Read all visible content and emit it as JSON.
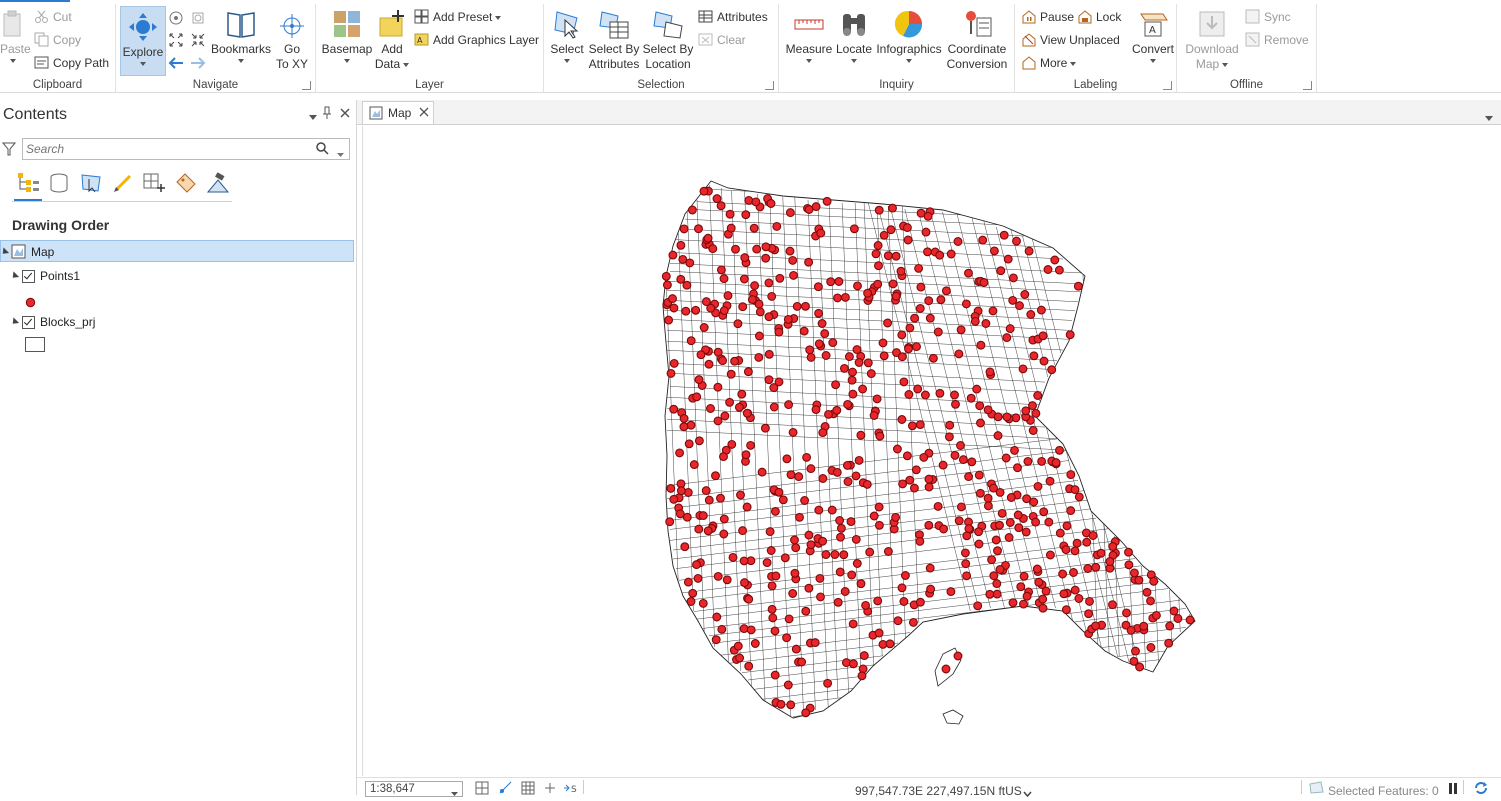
{
  "ribbon": {
    "clipboard": {
      "label": "Clipboard",
      "paste": "Paste",
      "cut": "Cut",
      "copy": "Copy",
      "copy_path": "Copy Path"
    },
    "navigate": {
      "label": "Navigate",
      "explore": "Explore",
      "bookmarks": "Bookmarks",
      "go_to_xy_line1": "Go",
      "go_to_xy_line2": "To XY"
    },
    "layer": {
      "label": "Layer",
      "basemap": "Basemap",
      "add_data_line1": "Add",
      "add_data_line2": "Data",
      "add_preset": "Add Preset",
      "add_graphics_layer": "Add Graphics Layer"
    },
    "selection": {
      "label": "Selection",
      "select": "Select",
      "select_by_attributes_line1": "Select By",
      "select_by_attributes_line2": "Attributes",
      "select_by_location_line1": "Select By",
      "select_by_location_line2": "Location",
      "attributes": "Attributes",
      "clear": "Clear"
    },
    "inquiry": {
      "label": "Inquiry",
      "measure": "Measure",
      "locate": "Locate",
      "infographics": "Infographics",
      "coordinate_conversion_line1": "Coordinate",
      "coordinate_conversion_line2": "Conversion"
    },
    "labeling": {
      "label": "Labeling",
      "pause": "Pause",
      "lock": "Lock",
      "view_unplaced": "View Unplaced",
      "more": "More",
      "convert": "Convert"
    },
    "offline": {
      "label": "Offline",
      "download_map_line1": "Download",
      "download_map_line2": "Map",
      "sync": "Sync",
      "remove": "Remove"
    }
  },
  "contents": {
    "title": "Contents",
    "search_placeholder": "Search",
    "drawing_order": "Drawing Order",
    "layers": {
      "map": "Map",
      "points": "Points1",
      "blocks": "Blocks_prj"
    }
  },
  "map_view": {
    "tab_label": "Map",
    "colors": {
      "point_fill": "#e8262c",
      "point_stroke": "#7a0a0a",
      "line": "#222222"
    }
  },
  "status": {
    "scale": "1:38,647",
    "coordinates": "997,547.73E 227,497.15N ftUS",
    "selected_features": "Selected Features: 0"
  }
}
